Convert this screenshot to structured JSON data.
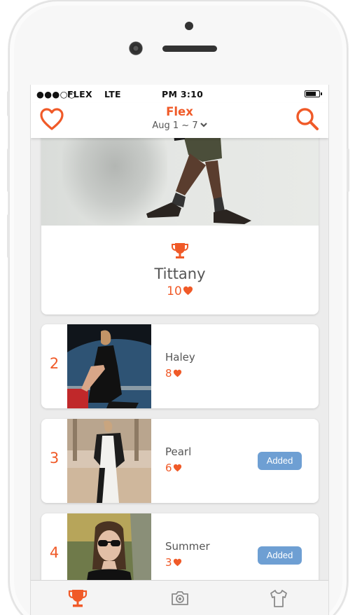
{
  "status_bar": {
    "signal": "●●●○○",
    "carrier": "FLEX",
    "network": "LTE",
    "time": "PM  3:10"
  },
  "header": {
    "title": "Flex",
    "date_range": "Aug  1 ~ 7",
    "left_icon": "heart-icon",
    "right_icon": "search-icon"
  },
  "top_entry": {
    "name": "Tittany",
    "likes": "10",
    "icon": "trophy-icon"
  },
  "ranking": [
    {
      "rank": "2",
      "name": "Haley",
      "likes": "8",
      "action": ""
    },
    {
      "rank": "3",
      "name": "Pearl",
      "likes": "6",
      "action": "Added"
    },
    {
      "rank": "4",
      "name": "Summer",
      "likes": "3",
      "action": "Added"
    }
  ],
  "tabs": [
    {
      "icon": "trophy-icon",
      "active": true
    },
    {
      "icon": "camera-icon",
      "active": false
    },
    {
      "icon": "tshirt-icon",
      "active": false
    }
  ],
  "colors": {
    "accent": "#f05a28",
    "added_button": "#6e9fd3",
    "text": "#555555",
    "background": "#ececec"
  }
}
